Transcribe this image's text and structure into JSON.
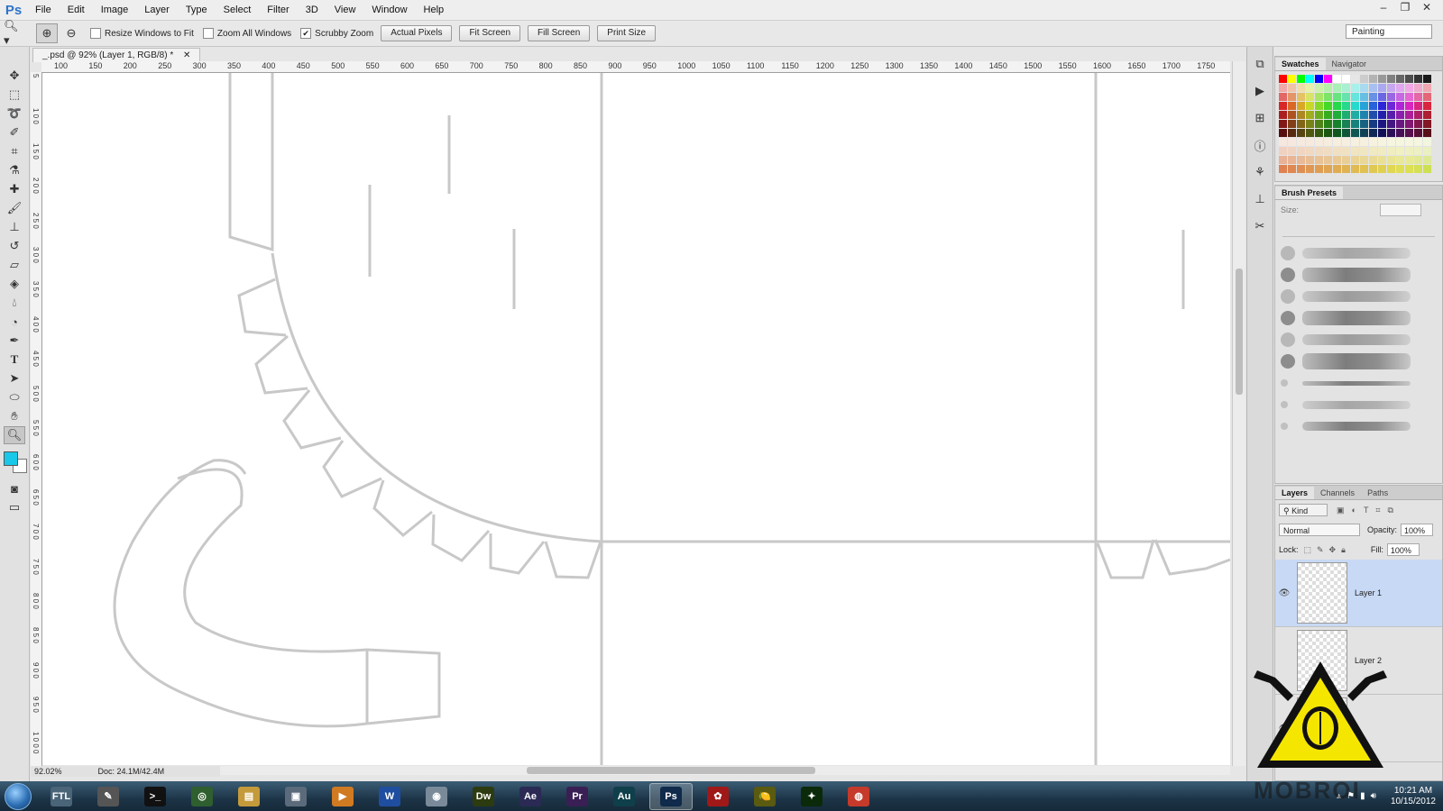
{
  "app": {
    "logo": "Ps"
  },
  "menu": [
    "File",
    "Edit",
    "Image",
    "Layer",
    "Type",
    "Select",
    "Filter",
    "3D",
    "View",
    "Window",
    "Help"
  ],
  "window_controls": [
    "–",
    "❐",
    "✕"
  ],
  "options_bar": {
    "checkboxes": [
      {
        "label": "Resize Windows to Fit",
        "checked": false
      },
      {
        "label": "Zoom All Windows",
        "checked": false
      },
      {
        "label": "Scrubby Zoom",
        "checked": true
      }
    ],
    "buttons": [
      "Actual Pixels",
      "Fit Screen",
      "Fill Screen",
      "Print Size"
    ],
    "workspace": "Painting"
  },
  "document": {
    "tab_title": "_.psd @ 92% (Layer 1, RGB/8) *",
    "close_glyph": "✕",
    "ruler_h": [
      "100",
      "150",
      "200",
      "250",
      "300",
      "350",
      "400",
      "450",
      "500",
      "550",
      "600",
      "650",
      "700",
      "750",
      "800",
      "850",
      "900",
      "950",
      "1000",
      "1050",
      "1100",
      "1150",
      "1200",
      "1250",
      "1300",
      "1350",
      "1400",
      "1450",
      "1500",
      "1550",
      "1600",
      "1650",
      "1700",
      "1750"
    ],
    "ruler_v": [
      "5",
      "1 0 0",
      "1 5 0",
      "2 0 0",
      "2 5 0",
      "3 0 0",
      "3 5 0",
      "4 0 0",
      "4 5 0",
      "5 0 0",
      "5 5 0",
      "6 0 0",
      "6 5 0",
      "7 0 0",
      "7 5 0",
      "8 0 0",
      "8 5 0",
      "9 0 0",
      "9 5 0",
      "1 0 0 0"
    ]
  },
  "status": {
    "zoom": "92.02%",
    "doc": "Doc: 24.1M/42.4M"
  },
  "panels": {
    "swatches_tabs": [
      "Swatches",
      "Navigator"
    ],
    "brush_presets": {
      "title": "Brush Presets",
      "size_label": "Size:"
    },
    "layers": {
      "tabs": [
        "Layers",
        "Channels",
        "Paths"
      ],
      "kind_label": "Kind",
      "blend_mode": "Normal",
      "opacity_label": "Opacity:",
      "opacity": "100%",
      "lock_label": "Lock:",
      "fill_label": "Fill:",
      "fill": "100%",
      "items": [
        {
          "name": "Layer 1",
          "visible": true,
          "selected": true
        },
        {
          "name": "Layer 2",
          "visible": false,
          "selected": false
        },
        {
          "name": "",
          "visible": true,
          "selected": false
        }
      ]
    }
  },
  "colors": {
    "foreground": "#19c8e8",
    "background": "#ffffff",
    "selection": "#c7d9f5",
    "guide": "#c8c8c8"
  },
  "taskbar": {
    "apps": [
      {
        "label": "FTL",
        "color": "#4a6478"
      },
      {
        "label": "✎",
        "color": "#555555"
      },
      {
        "label": ">_",
        "color": "#111111"
      },
      {
        "label": "◎",
        "color": "#2f5f2f"
      },
      {
        "label": "▤",
        "color": "#c49a3b"
      },
      {
        "label": "▣",
        "color": "#5b6b7b"
      },
      {
        "label": "▶",
        "color": "#d07a22"
      },
      {
        "label": "W",
        "color": "#1f4ea0"
      },
      {
        "label": "◉",
        "color": "#7a8a99"
      },
      {
        "label": "Dw",
        "color": "#2d3b10"
      },
      {
        "label": "Ae",
        "color": "#2a2a55"
      },
      {
        "label": "Pr",
        "color": "#3a1f55"
      },
      {
        "label": "Au",
        "color": "#0f3f4a"
      },
      {
        "label": "Ps",
        "color": "#0f2a4a",
        "active": true
      },
      {
        "label": "✿",
        "color": "#a01818"
      },
      {
        "label": "🍋",
        "color": "#5a5a10"
      },
      {
        "label": "✦",
        "color": "#0a2a0a"
      },
      {
        "label": "◍",
        "color": "#c53a2a"
      }
    ],
    "clock_time": "10:21 AM",
    "clock_date": "10/15/2012"
  },
  "watermark": {
    "text": "MOBROI"
  }
}
